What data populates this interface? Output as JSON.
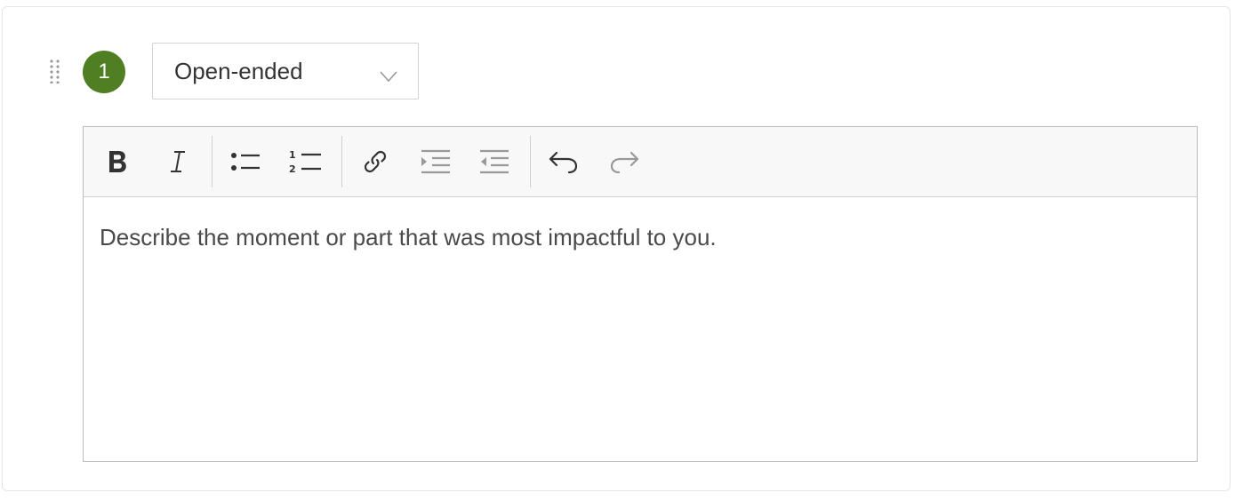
{
  "question": {
    "number": "1",
    "type_select": {
      "selected": "Open-ended"
    },
    "editor": {
      "content": "Describe the moment or part that was most impactful to you.",
      "toolbar": [
        {
          "name": "bold-button",
          "icon": "bold-icon"
        },
        {
          "name": "italic-button",
          "icon": "italic-icon"
        },
        {
          "name": "bullet-list-button",
          "icon": "bullet-list-icon"
        },
        {
          "name": "numbered-list-button",
          "icon": "numbered-list-icon"
        },
        {
          "name": "link-button",
          "icon": "link-icon"
        },
        {
          "name": "indent-button",
          "icon": "indent-icon"
        },
        {
          "name": "outdent-button",
          "icon": "outdent-icon"
        },
        {
          "name": "undo-button",
          "icon": "undo-icon"
        },
        {
          "name": "redo-button",
          "icon": "redo-icon",
          "disabled": true
        }
      ]
    }
  },
  "colors": {
    "badge": "#507f23",
    "icon": "#333333",
    "icon_muted": "#999999",
    "border": "#bdbdbd"
  }
}
